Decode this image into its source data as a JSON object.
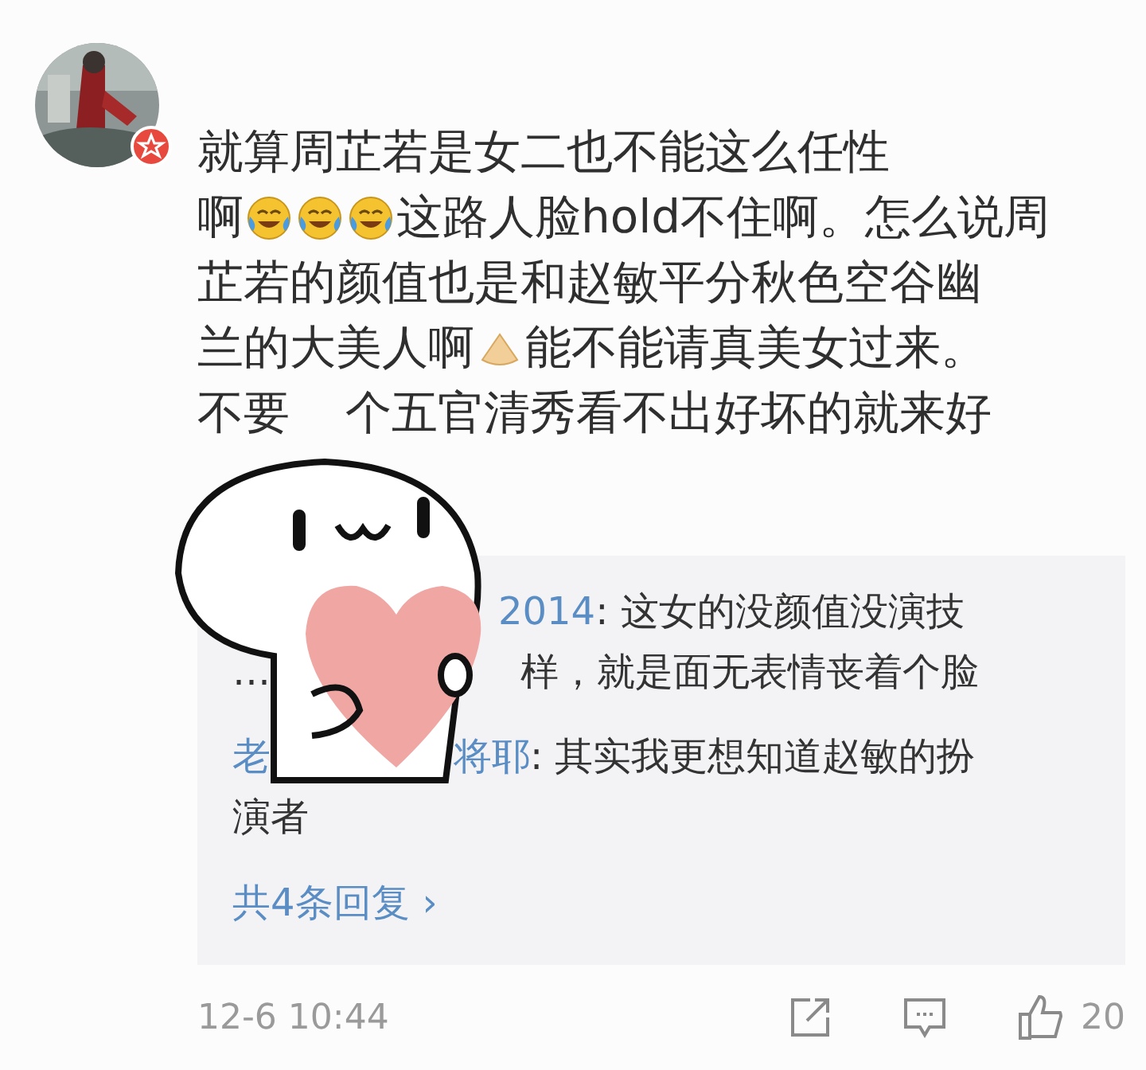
{
  "comment": {
    "lines": [
      [
        {
          "kind": "text",
          "text": "就算周芷若是女二也不能这么任性"
        }
      ],
      [
        {
          "kind": "text",
          "text": "啊"
        },
        {
          "kind": "laugh_cry_emoji"
        },
        {
          "kind": "laugh_cry_emoji"
        },
        {
          "kind": "laugh_cry_emoji"
        },
        {
          "kind": "text",
          "text": "这路人脸hold不住啊。怎么说周"
        }
      ],
      [
        {
          "kind": "text",
          "text": "芷若的颜值也是和赵敏平分秋色空谷幽"
        }
      ],
      [
        {
          "kind": "text",
          "text": "兰的大美人啊"
        },
        {
          "kind": "pray_emoji"
        },
        {
          "kind": "text",
          "text": "能不能请真美女过来。"
        }
      ],
      [
        {
          "kind": "text",
          "text": "不要"
        },
        {
          "kind": "covered"
        },
        {
          "kind": "text",
          "text": "个五官清秀看不出好坏的就来好"
        }
      ]
    ]
  },
  "replies": [
    {
      "lines": [
        [
          {
            "kind": "covered"
          },
          {
            "kind": "name",
            "text": "2014"
          },
          {
            "kind": "text",
            "text": ": 这女的没颜值没演技"
          }
        ],
        [
          {
            "kind": "text",
            "text": "…"
          },
          {
            "kind": "covered"
          },
          {
            "kind": "text",
            "text": "样，就是面无表情丧着个脸"
          }
        ]
      ]
    },
    {
      "lines": [
        [
          {
            "kind": "name",
            "text": "老"
          },
          {
            "kind": "covered"
          },
          {
            "kind": "name",
            "text": "将耶"
          },
          {
            "kind": "text",
            "text": ": 其实我更想知道赵敏的扮"
          }
        ],
        [
          {
            "kind": "text",
            "text": "演者"
          }
        ]
      ]
    }
  ],
  "more_replies": {
    "label": "共4条回复",
    "chevron": "›"
  },
  "footer": {
    "time": "12-6 10:44",
    "like_count": "20"
  }
}
